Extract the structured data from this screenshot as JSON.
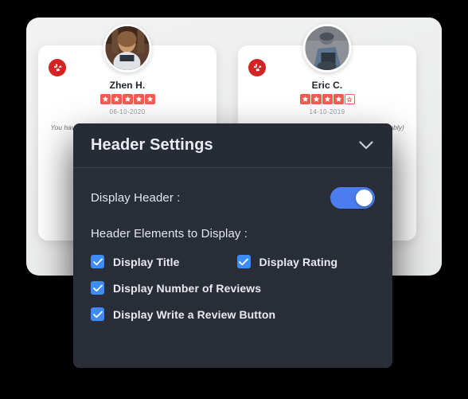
{
  "reviews": [
    {
      "platform_icon": "yelp-burst-icon",
      "avatar": "reviewer-avatar",
      "name": "Zhen H.",
      "rating": 5,
      "max_rating": 5,
      "date": "06-10-2020",
      "text": "You have to swing by for a quick hearty lunch, shes right"
    },
    {
      "platform_icon": "yelp-burst-icon",
      "avatar": "reviewer-avatar",
      "name": "Eric C.",
      "rating": 4,
      "max_rating": 5,
      "date": "14-10-2019",
      "text": "Bottomline: Good comfort food from a (presumably) to Kar"
    }
  ],
  "settings_panel": {
    "title": "Header Settings",
    "collapse_icon": "chevron-down-icon",
    "display_header": {
      "label": "Display Header :",
      "toggle_on": true
    },
    "elements_section": {
      "label": "Header Elements to Display :",
      "checkboxes": [
        {
          "label": "Display Title",
          "checked": true
        },
        {
          "label": "Display Rating",
          "checked": true
        },
        {
          "label": "Display Number of Reviews",
          "checked": true
        },
        {
          "label": "Display Write a Review Button",
          "checked": true
        }
      ]
    }
  },
  "colors": {
    "panel_bg": "#282d37",
    "panel_header_bg": "#262b35",
    "accent_blue": "#4b7df0",
    "checkbox_blue": "#3d8bfd",
    "star_red": "#f15c4f",
    "yelp_red": "#d32323",
    "stage_bg": "#f2f2f3",
    "page_bg": "#000000"
  }
}
